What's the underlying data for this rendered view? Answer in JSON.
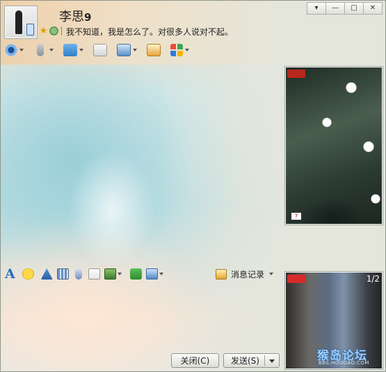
{
  "contact": {
    "name": "李思",
    "name_suffix": "9",
    "signature": "我不知道，我是怎么了。对很多人说对不起。"
  },
  "window_controls": {
    "menu": "▾",
    "minimize": "—",
    "maximize": "□",
    "close": "✕"
  },
  "top_toolbar": [
    "video-call",
    "voice-call",
    "transfer-file",
    "create-discussion",
    "remote-assist",
    "share-screen",
    "app-center"
  ],
  "input_toolbar": {
    "font_label": "A",
    "history_label": "消息记录"
  },
  "video": {
    "peer_badge": "",
    "self_badge": "",
    "page_counter": "1/2"
  },
  "watermark": {
    "title": "猴岛论坛",
    "subtitle": "BBS.HOUDAO.COM"
  },
  "buttons": {
    "close": "关闭(C)",
    "send": "发送(S)"
  }
}
